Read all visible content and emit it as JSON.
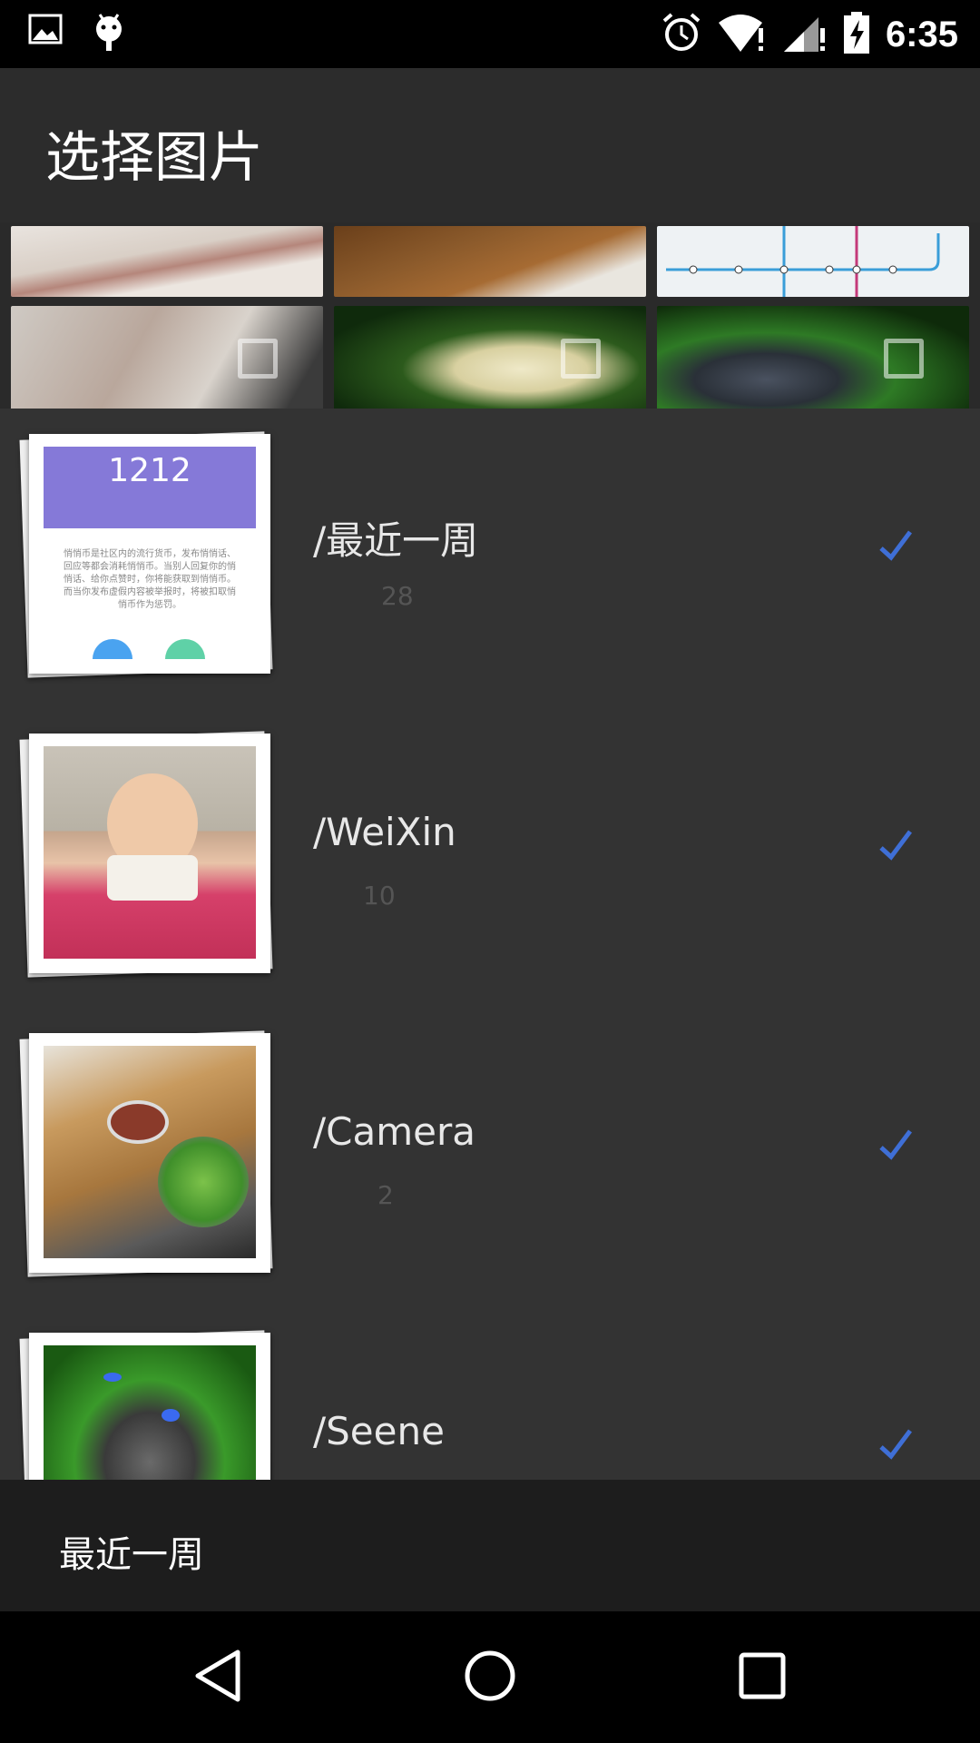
{
  "status_bar": {
    "time": "6:35",
    "left_icons": [
      "image-icon",
      "android-icon"
    ],
    "right_icons": [
      "alarm-icon",
      "wifi-icon",
      "signal-icon",
      "battery-charging-icon"
    ]
  },
  "app_bar": {
    "title": "选择图片"
  },
  "folders": [
    {
      "name": "/最近一周",
      "count": "28",
      "cover_text": "1212",
      "cover_body": "悄悄币是社区内的流行货币，发布悄悄话、回应等都会消耗悄悄币。当别人回复你的悄悄话、给你点赞时，你将能获取到悄悄币。而当你发布虚假内容被举报时，将被扣取悄悄币作为惩罚。"
    },
    {
      "name": "/WeiXin",
      "count": "10"
    },
    {
      "name": "/Camera",
      "count": "2"
    },
    {
      "name": "/Seene",
      "count": ""
    }
  ],
  "bottom_bar": {
    "current_folder": "最近一周"
  },
  "colors": {
    "accent": "#3f6fd6",
    "card_purple": "#8579d8",
    "list_bg": "#333333"
  }
}
